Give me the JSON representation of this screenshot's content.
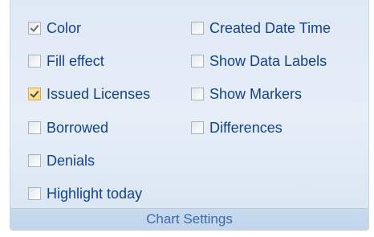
{
  "chart_settings": {
    "left_column": [
      {
        "label": "Color",
        "checked": true,
        "style": "gray"
      },
      {
        "label": "Fill effect",
        "checked": false
      },
      {
        "label": "Issued Licenses",
        "checked": true,
        "style": "orange"
      },
      {
        "label": "Borrowed",
        "checked": false
      },
      {
        "label": "Denials",
        "checked": false
      },
      {
        "label": "Highlight today",
        "checked": false
      }
    ],
    "right_column": [
      {
        "label": "Created Date Time",
        "checked": false
      },
      {
        "label": "Show Data Labels",
        "checked": false
      },
      {
        "label": "Show Markers",
        "checked": false
      },
      {
        "label": "Differences",
        "checked": false
      }
    ],
    "group_title": "Chart Settings"
  }
}
